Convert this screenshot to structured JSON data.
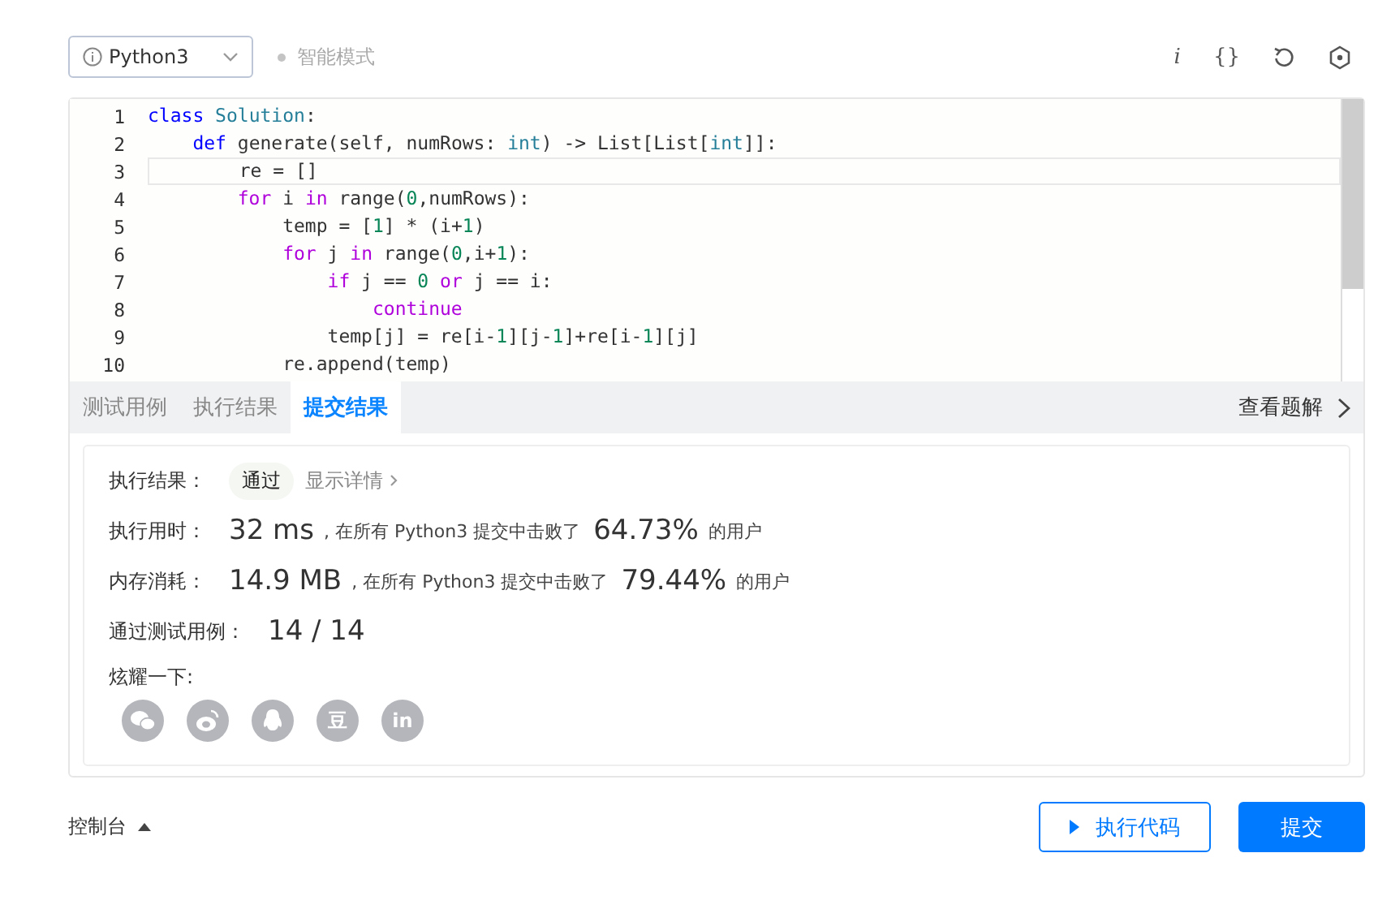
{
  "toolbar": {
    "language": "Python3",
    "mode": {
      "label": "智能模式",
      "on": false
    },
    "tools": [
      {
        "kind": "glyph",
        "text": "i"
      },
      {
        "kind": "glyph",
        "text": "{}"
      },
      {
        "kind": "reset"
      },
      {
        "kind": "settings"
      }
    ]
  },
  "editor": {
    "lines": [
      {
        "number": "1",
        "current": false,
        "tokens": [
          {
            "kind": "keyword",
            "text": "class"
          },
          {
            "kind": "type",
            "text": " Solution"
          },
          {
            "kind": "plain",
            "text": ":"
          }
        ]
      },
      {
        "number": "2",
        "current": false,
        "tokens": [
          {
            "kind": "keyword",
            "text": "    def"
          },
          {
            "kind": "plain",
            "text": " generate(self, numRows: "
          },
          {
            "kind": "type",
            "text": "int"
          },
          {
            "kind": "plain",
            "text": ") -> List[List["
          },
          {
            "kind": "type",
            "text": "int"
          },
          {
            "kind": "plain",
            "text": "]]:"
          }
        ]
      },
      {
        "number": "3",
        "current": true,
        "tokens": [
          {
            "kind": "plain",
            "text": "        re = []"
          }
        ]
      },
      {
        "number": "4",
        "current": false,
        "tokens": [
          {
            "kind": "control",
            "text": "        for"
          },
          {
            "kind": "plain",
            "text": " i "
          },
          {
            "kind": "control",
            "text": "in"
          },
          {
            "kind": "plain",
            "text": " range("
          },
          {
            "kind": "number",
            "text": "0"
          },
          {
            "kind": "plain",
            "text": ",numRows):"
          }
        ]
      },
      {
        "number": "5",
        "current": false,
        "tokens": [
          {
            "kind": "plain",
            "text": "            temp = ["
          },
          {
            "kind": "number",
            "text": "1"
          },
          {
            "kind": "plain",
            "text": "] * (i+"
          },
          {
            "kind": "number",
            "text": "1"
          },
          {
            "kind": "plain",
            "text": ")"
          }
        ]
      },
      {
        "number": "6",
        "current": false,
        "tokens": [
          {
            "kind": "control",
            "text": "            for"
          },
          {
            "kind": "plain",
            "text": " j "
          },
          {
            "kind": "control",
            "text": "in"
          },
          {
            "kind": "plain",
            "text": " range("
          },
          {
            "kind": "number",
            "text": "0"
          },
          {
            "kind": "plain",
            "text": ",i+"
          },
          {
            "kind": "number",
            "text": "1"
          },
          {
            "kind": "plain",
            "text": "):"
          }
        ]
      },
      {
        "number": "7",
        "current": false,
        "tokens": [
          {
            "kind": "control",
            "text": "                if"
          },
          {
            "kind": "plain",
            "text": " j == "
          },
          {
            "kind": "number",
            "text": "0"
          },
          {
            "kind": "control",
            "text": " or"
          },
          {
            "kind": "plain",
            "text": " j == i:"
          }
        ]
      },
      {
        "number": "8",
        "current": false,
        "tokens": [
          {
            "kind": "control",
            "text": "                    continue"
          }
        ]
      },
      {
        "number": "9",
        "current": false,
        "tokens": [
          {
            "kind": "plain",
            "text": "                temp[j] = re[i-"
          },
          {
            "kind": "number",
            "text": "1"
          },
          {
            "kind": "plain",
            "text": "][j-"
          },
          {
            "kind": "number",
            "text": "1"
          },
          {
            "kind": "plain",
            "text": "]+re[i-"
          },
          {
            "kind": "number",
            "text": "1"
          },
          {
            "kind": "plain",
            "text": "][j]"
          }
        ]
      },
      {
        "number": "10",
        "current": false,
        "tokens": [
          {
            "kind": "plain",
            "text": "            re.append(temp)"
          }
        ]
      }
    ]
  },
  "tabs": [
    {
      "label": "测试用例",
      "selected": false
    },
    {
      "label": "执行结果",
      "selected": false
    },
    {
      "label": "提交结果",
      "selected": true
    }
  ],
  "solution_link": "查看题解",
  "result": {
    "status_label": "执行结果：",
    "status": "通过",
    "details_link": "显示详情",
    "stats": [
      {
        "label": "执行用时：",
        "value": "32 ms",
        "text": ", 在所有 Python3 提交中击败了",
        "percent": "64.73%",
        "suffix": "的用户"
      },
      {
        "label": "内存消耗：",
        "value": "14.9 MB",
        "text": ", 在所有 Python3 提交中击败了",
        "percent": "79.44%",
        "suffix": "的用户"
      }
    ],
    "cases_label": "通过测试用例：",
    "cases": "14 / 14",
    "share_label": "炫耀一下:",
    "share": [
      {
        "kind": "bubbles"
      },
      {
        "kind": "swirl"
      },
      {
        "kind": "penguin"
      },
      {
        "kind": "glyph",
        "text": "豆"
      },
      {
        "kind": "glyph",
        "text": "in"
      }
    ]
  },
  "footer": {
    "console": "控制台",
    "run": "执行代码",
    "submit": "提交"
  }
}
